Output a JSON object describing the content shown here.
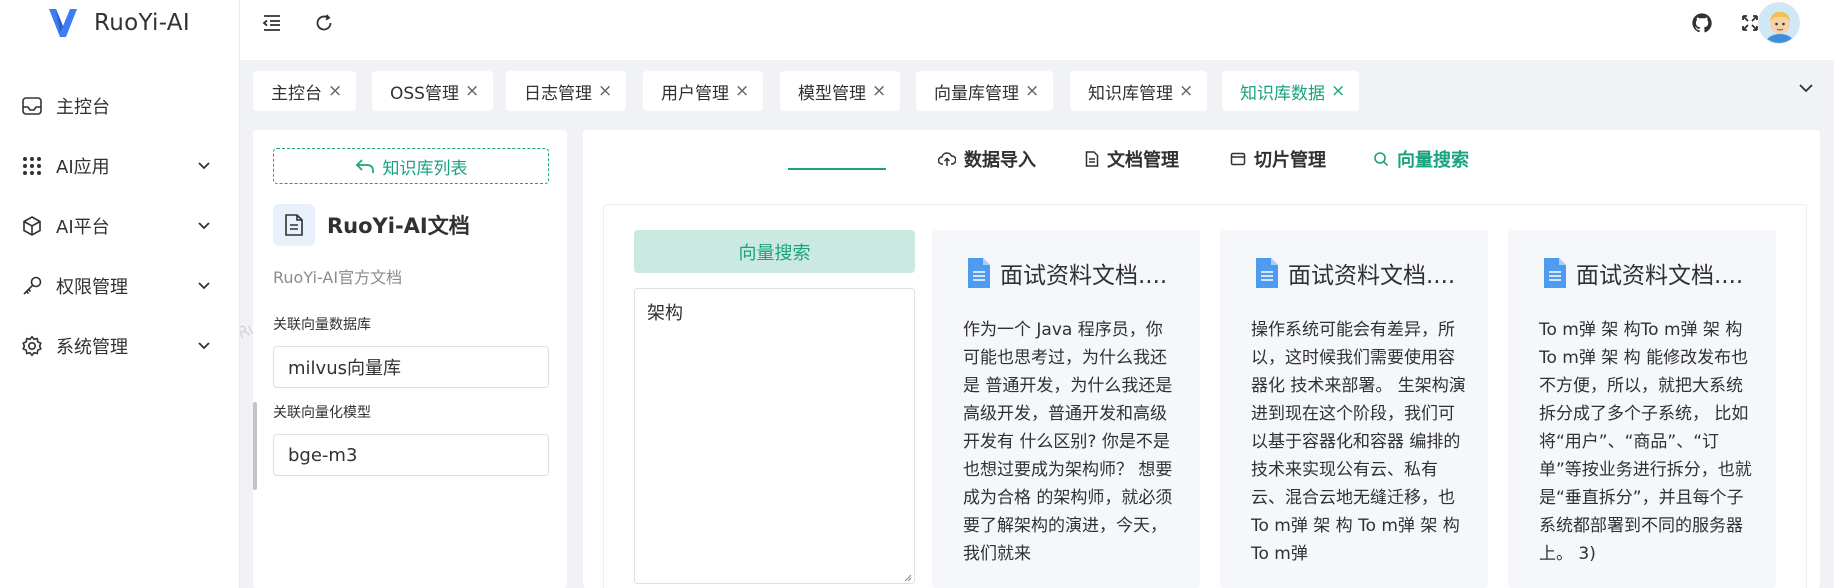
{
  "app": {
    "name": "RuoYi-AI"
  },
  "sidebar": {
    "items": [
      {
        "label": "主控台",
        "icon": "inbox-icon",
        "has_children": false
      },
      {
        "label": "AI应用",
        "icon": "grid-dots-icon",
        "has_children": true
      },
      {
        "label": "AI平台",
        "icon": "cube-icon",
        "has_children": true
      },
      {
        "label": "权限管理",
        "icon": "key-icon",
        "has_children": true
      },
      {
        "label": "系统管理",
        "icon": "gear-icon",
        "has_children": true
      }
    ]
  },
  "header": {
    "icons": [
      "menu-fold-icon",
      "refresh-icon",
      "github-icon",
      "fullscreen-icon",
      "avatar"
    ]
  },
  "tags": [
    {
      "label": "主控台",
      "active": false
    },
    {
      "label": "OSS管理",
      "active": false
    },
    {
      "label": "日志管理",
      "active": false
    },
    {
      "label": "用户管理",
      "active": false
    },
    {
      "label": "模型管理",
      "active": false
    },
    {
      "label": "向量库管理",
      "active": false
    },
    {
      "label": "知识库管理",
      "active": false
    },
    {
      "label": "知识库数据",
      "active": true
    }
  ],
  "knowledge": {
    "back_label": "知识库列表",
    "title": "RuoYi-AI文档",
    "description": "RuoYi-AI官方文档",
    "vector_db_label": "关联向量数据库",
    "vector_db_value": "milvus向量库",
    "vector_model_label": "关联向量化模型",
    "vector_model_value": "bge-m3"
  },
  "main_tabs": [
    {
      "label": "数据导入",
      "icon": "cloud-upload-icon",
      "active": false
    },
    {
      "label": "文档管理",
      "icon": "document-icon",
      "active": false
    },
    {
      "label": "切片管理",
      "icon": "folder-icon",
      "active": false
    },
    {
      "label": "向量搜索",
      "icon": "search-icon",
      "active": true
    }
  ],
  "search": {
    "button_label": "向量搜索",
    "query": "架构"
  },
  "results": [
    {
      "title": "面试资料文档....",
      "content": "作为一个 Java 程序员，你可能也思考过，为什么我还是 普通开发，为什么我还是高级开发，普通开发和高级开发有 什么区别? 你是不是也想过要成为架构师？ 想要成为合格 的架构师，就必须要了解架构的演进，今天，我们就来"
    },
    {
      "title": "面试资料文档....",
      "content": "操作系统可能会有差异，所以，这时候我们需要使用容器化 技术来部署。 生架构演进到现在这个阶段，我们可以基于容器化和容器 编排的技术来实现公有云、私有云、混合云地无缝迁移，也 To m弹 架 构 To m弹 架 构To m弹"
    },
    {
      "title": "面试资料文档....",
      "content": "To m弹 架 构To m弹 架 构 To m弹 架 构 能修改发布也不方便，所以，就把大系统拆分成了多个子系统， 比如将“用户”、“商品”、“订单”等按业务进行拆分，也就 是“垂直拆分”，并且每个子系统都部署到不同的服务器上。 3)"
    }
  ],
  "watermark": "RuoYi-AI",
  "colors": {
    "accent": "#1aa37e",
    "accent_light": "#c9e9e1"
  }
}
